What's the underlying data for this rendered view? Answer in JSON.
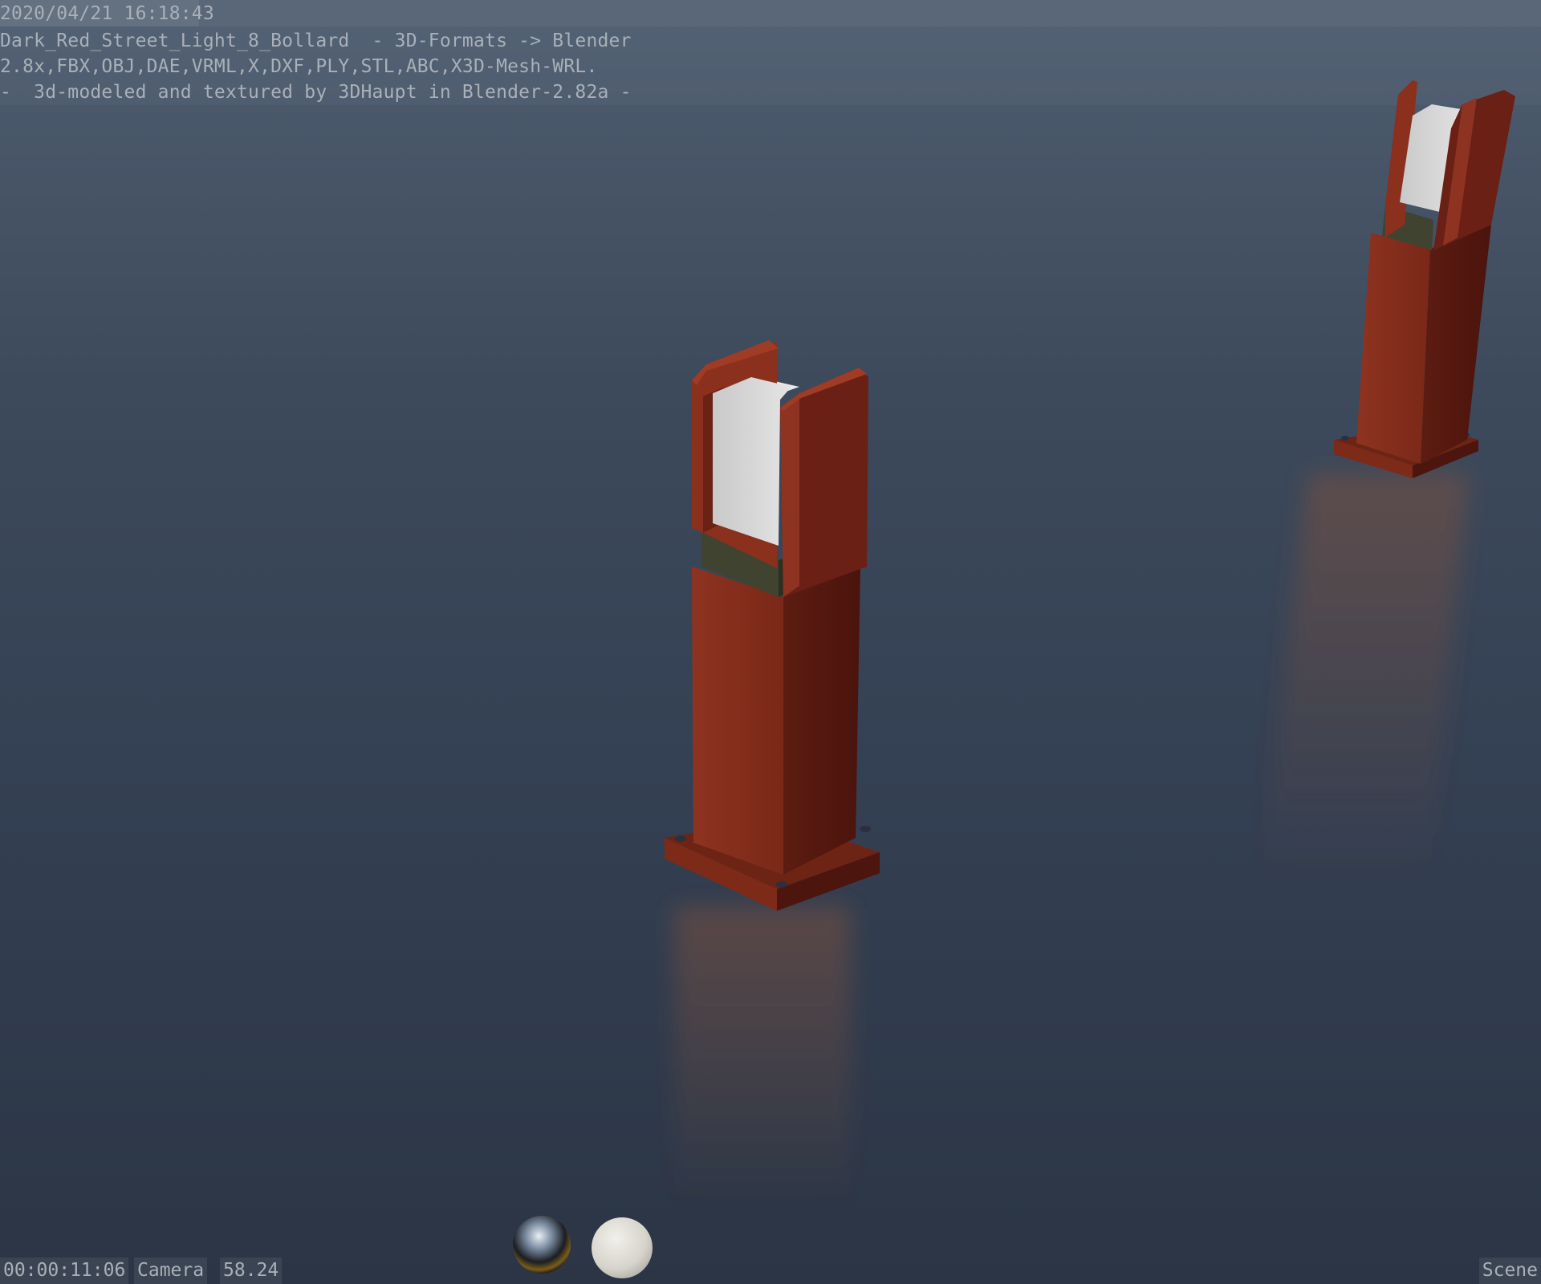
{
  "header": {
    "timestamp": "2020/04/21 16:18:43",
    "line1": "Dark_Red_Street_Light_8_Bollard  - 3D-Formats -> Blender",
    "line2": "2.8x,FBX,OBJ,DAE,VRML,X,DXF,PLY,STL,ABC,X3D-Mesh-WRL.",
    "line3": "-  3d-modeled and textured by 3DHaupt in Blender-2.82a -"
  },
  "footer": {
    "time": "00:00:11:06",
    "camera": "Camera",
    "lens": "58.24",
    "scene": "Scene"
  },
  "viewport": {
    "objects": [
      "bollard-near",
      "bollard-far"
    ],
    "matcaps": [
      "chrome-sphere",
      "white-sphere"
    ],
    "colors": {
      "bollard_red": "#8a2f1e",
      "bollard_red_dark": "#5e1a12",
      "diffuser": "#d9d9d9",
      "floor_top": "#4f5d70",
      "floor_bottom": "#2b3545"
    }
  }
}
